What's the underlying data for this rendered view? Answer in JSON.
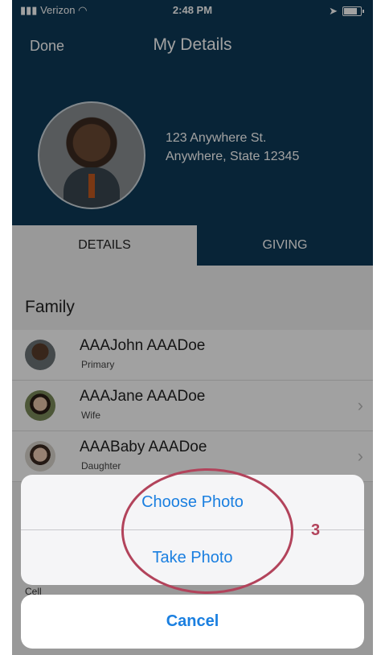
{
  "status": {
    "carrier": "Verizon",
    "time": "2:48 PM"
  },
  "nav": {
    "done_label": "Done",
    "title": "My Details"
  },
  "address": {
    "line1": "123 Anywhere St.",
    "line2": "Anywhere, State 12345"
  },
  "tabs": [
    {
      "label": "DETAILS"
    },
    {
      "label": "GIVING"
    }
  ],
  "family": {
    "heading": "Family",
    "members": [
      {
        "name": "AAAJohn AAADoe",
        "role": "Primary"
      },
      {
        "name": "AAAJane AAADoe",
        "role": "Wife"
      },
      {
        "name": "AAABaby AAADoe",
        "role": "Daughter"
      }
    ]
  },
  "partial_label": "Cell",
  "action_sheet": {
    "choose_photo": "Choose Photo",
    "take_photo": "Take Photo",
    "cancel": "Cancel"
  },
  "annotation": {
    "step": "3"
  },
  "colors": {
    "header": "#0e3a57",
    "action": "#1a7fe0",
    "callout": "#b2435b"
  }
}
